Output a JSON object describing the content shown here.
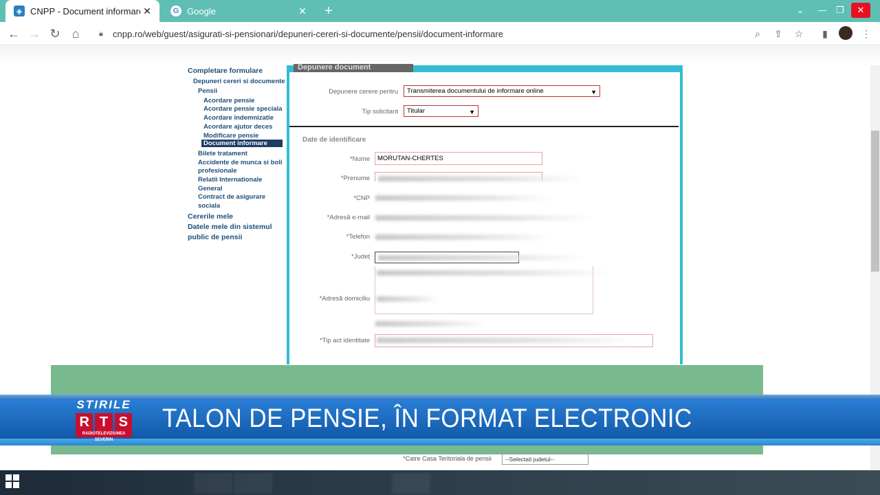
{
  "browser": {
    "tabs": [
      {
        "label": "CNPP - Document informare",
        "active": true,
        "icon": "cnpp-favicon"
      },
      {
        "label": "Google",
        "active": false,
        "icon": "google-favicon"
      }
    ],
    "url": "cnpp.ro/web/guest/asigurati-si-pensionari/depuneri-cereri-si-documente/pensii/document-informare"
  },
  "sidebar": {
    "items": [
      {
        "label": "Completare formulare",
        "level": 0
      },
      {
        "label": "Depuneri cereri si documente",
        "level": 1
      },
      {
        "label": "Pensii",
        "level": 2
      },
      {
        "label": "Acordare pensie",
        "level": 3
      },
      {
        "label": "Acordare pensie speciala",
        "level": 3
      },
      {
        "label": "Acordare indemnizatie",
        "level": 3
      },
      {
        "label": "Acordare ajutor deces",
        "level": 3
      },
      {
        "label": "Modificare pensie",
        "level": 3
      },
      {
        "label": "Document informare",
        "level": 3,
        "current": true
      },
      {
        "label": "Bilete tratament",
        "level": 2
      },
      {
        "label": "Accidente de munca si boli",
        "level": 2
      },
      {
        "label": "profesionale",
        "level": 2
      },
      {
        "label": "Relatii Internationale",
        "level": 2
      },
      {
        "label": "General",
        "level": 2
      },
      {
        "label": "Contract de asigurare",
        "level": 2
      },
      {
        "label": "sociala",
        "level": 2
      },
      {
        "label": "Cererile mele",
        "level": 0
      },
      {
        "label": "Datele mele din sistemul",
        "level": 0
      },
      {
        "label": "public de pensii",
        "level": 0
      }
    ]
  },
  "form": {
    "header_tab": "Depunere document",
    "depunere_label": "Depunere cerere pentru",
    "depunere_value": "Transmiterea documentului de informare online",
    "tip_label": "Tip solicitant",
    "tip_value": "Titular",
    "section_title": "Date de identificare",
    "fields": {
      "nume_label": "*Nume",
      "nume_value": "MORUTAN-CHERTES",
      "prenume_label": "*Prenume",
      "cnp_label": "*CNP",
      "email_label": "*Adresă e-mail",
      "telefon_label": "*Telefon",
      "judet_label": "*Județ",
      "adresa_label": "*Adresă domiciliu",
      "tip_act_label": "*Tip act identitate"
    },
    "lower_label": "*Catre Casa Teritoriala de pensii",
    "lower_select": "--Selectati judetul--"
  },
  "ticker": {
    "brand_top": "STIRILE",
    "brand_letters": [
      "R",
      "T",
      "S"
    ],
    "brand_sub": "RADIOTELEVIZIUNEA SEVERIN",
    "headline": "TALON DE PENSIE, ÎN FORMAT ELECTRONIC"
  },
  "colors": {
    "tabbar": "#5fbfb5",
    "panel_accent": "#33bcd4",
    "ticker_blue": "#1e6fc4",
    "rts_red": "#c8102e",
    "green_banner": "#79b98e"
  }
}
